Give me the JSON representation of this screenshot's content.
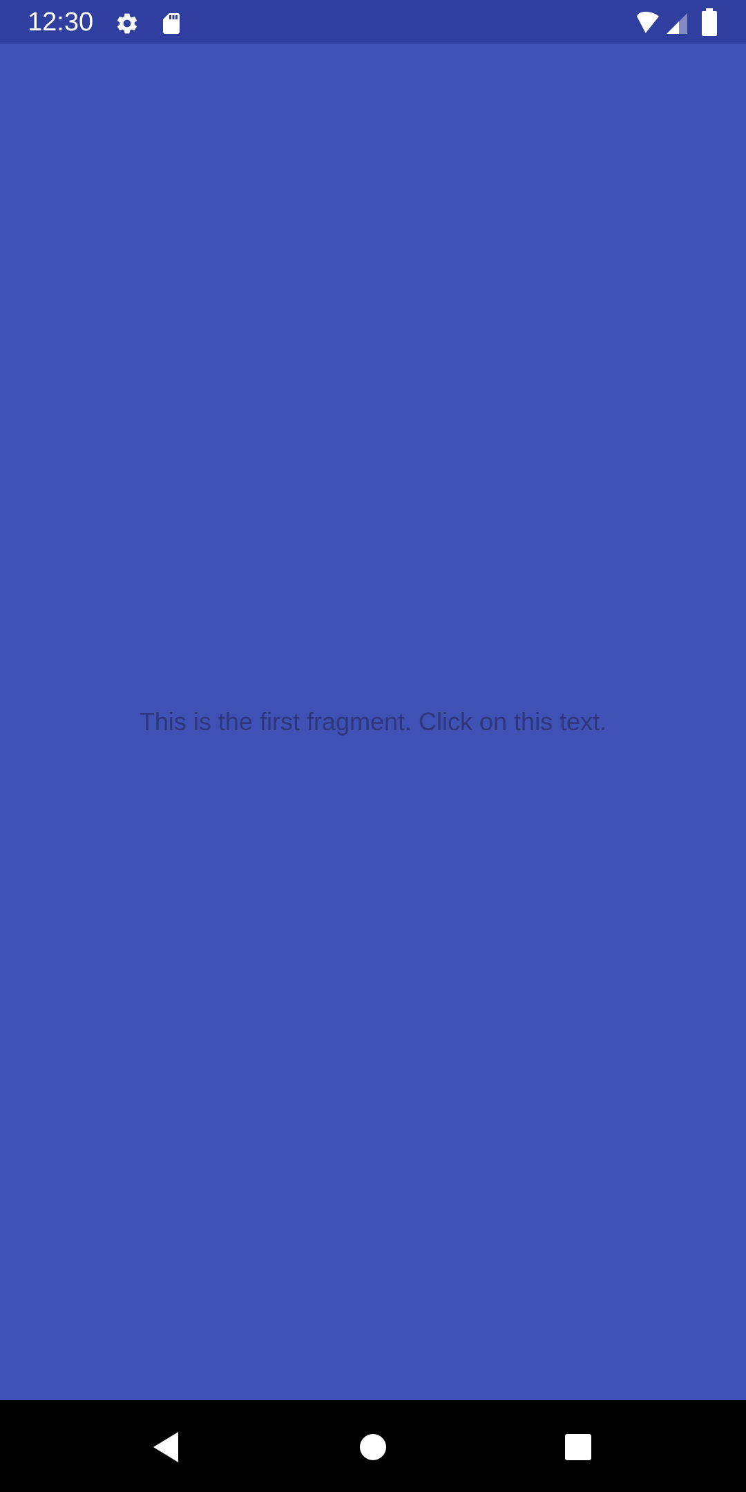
{
  "status_bar": {
    "time": "12:30",
    "icons": [
      "gear-icon",
      "sd-card-icon",
      "wifi-icon",
      "cell-signal-icon",
      "battery-icon"
    ]
  },
  "fragment": {
    "message": "This is the first fragment. Click on this text."
  },
  "nav_bar": {
    "buttons": [
      "back-icon",
      "home-icon",
      "recents-icon"
    ]
  },
  "colors": {
    "background": "#3f51b5",
    "status_bar": "#303f9f",
    "text": "#2d387a",
    "nav_bar": "#000000"
  }
}
